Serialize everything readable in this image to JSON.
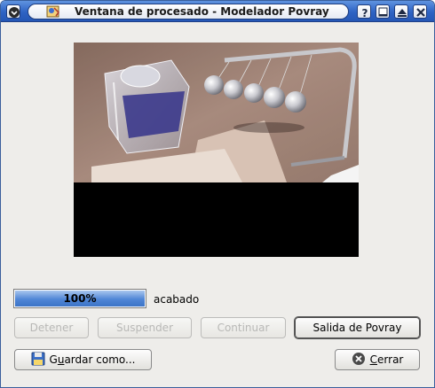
{
  "window": {
    "title": "Ventana de procesado - Modelador Povray"
  },
  "titlebar": {
    "menu_icon": "chevron-down-icon",
    "app_icon": "povray-app-icon",
    "buttons": [
      "help-icon",
      "minimize-icon",
      "maximize-icon",
      "close-icon"
    ]
  },
  "render_preview": {
    "description_icon": "rendered-image"
  },
  "progress": {
    "value": 1.0,
    "label": "100%",
    "status": "acabado"
  },
  "buttons": {
    "stop": "Detener",
    "suspend": "Suspender",
    "resume": "Continuar",
    "output": "Salida de Povray",
    "save_prefix": "G",
    "save_mnemonic": "u",
    "save_rest": "ardar como...",
    "close_mnemonic": "C",
    "close_rest": "errar"
  },
  "colors": {
    "titlebar": "#2e63c4",
    "progress_fill": "#4f86d6",
    "window_bg": "#eeedea"
  }
}
